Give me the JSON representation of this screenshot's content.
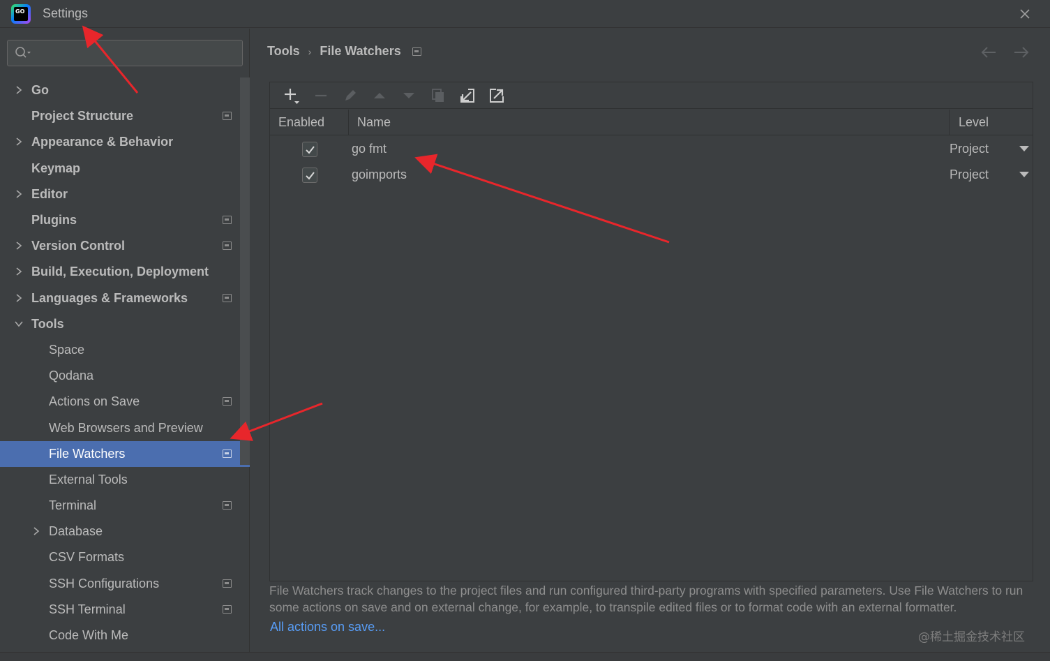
{
  "window": {
    "title": "Settings",
    "logo_text": "GO"
  },
  "search": {
    "placeholder": "",
    "value": ""
  },
  "sidebar": {
    "items": [
      {
        "label": "Go",
        "chevron": "right",
        "bold": true,
        "indent": 0,
        "proj": false
      },
      {
        "label": "Project Structure",
        "chevron": null,
        "bold": true,
        "indent": 0,
        "proj": true
      },
      {
        "label": "Appearance & Behavior",
        "chevron": "right",
        "bold": true,
        "indent": 0,
        "proj": false
      },
      {
        "label": "Keymap",
        "chevron": null,
        "bold": true,
        "indent": 0,
        "proj": false
      },
      {
        "label": "Editor",
        "chevron": "right",
        "bold": true,
        "indent": 0,
        "proj": false
      },
      {
        "label": "Plugins",
        "chevron": null,
        "bold": true,
        "indent": 0,
        "proj": true
      },
      {
        "label": "Version Control",
        "chevron": "right",
        "bold": true,
        "indent": 0,
        "proj": true
      },
      {
        "label": "Build, Execution, Deployment",
        "chevron": "right",
        "bold": true,
        "indent": 0,
        "proj": false
      },
      {
        "label": "Languages & Frameworks",
        "chevron": "right",
        "bold": true,
        "indent": 0,
        "proj": true
      },
      {
        "label": "Tools",
        "chevron": "down",
        "bold": true,
        "indent": 0,
        "proj": false
      },
      {
        "label": "Space",
        "chevron": null,
        "bold": false,
        "indent": 1,
        "proj": false
      },
      {
        "label": "Qodana",
        "chevron": null,
        "bold": false,
        "indent": 1,
        "proj": false
      },
      {
        "label": "Actions on Save",
        "chevron": null,
        "bold": false,
        "indent": 1,
        "proj": true
      },
      {
        "label": "Web Browsers and Preview",
        "chevron": null,
        "bold": false,
        "indent": 1,
        "proj": false
      },
      {
        "label": "File Watchers",
        "chevron": null,
        "bold": false,
        "indent": 1,
        "proj": true,
        "selected": true
      },
      {
        "label": "External Tools",
        "chevron": null,
        "bold": false,
        "indent": 1,
        "proj": false
      },
      {
        "label": "Terminal",
        "chevron": null,
        "bold": false,
        "indent": 1,
        "proj": true
      },
      {
        "label": "Database",
        "chevron": "right",
        "bold": false,
        "indent": 1,
        "proj": false
      },
      {
        "label": "CSV Formats",
        "chevron": null,
        "bold": false,
        "indent": 1,
        "proj": false
      },
      {
        "label": "SSH Configurations",
        "chevron": null,
        "bold": false,
        "indent": 1,
        "proj": true
      },
      {
        "label": "SSH Terminal",
        "chevron": null,
        "bold": false,
        "indent": 1,
        "proj": true
      },
      {
        "label": "Code With Me",
        "chevron": null,
        "bold": false,
        "indent": 1,
        "proj": false
      }
    ]
  },
  "breadcrumb": {
    "parent": "Tools",
    "separator": "›",
    "current": "File Watchers"
  },
  "toolbar": {
    "buttons": [
      {
        "name": "add-button",
        "icon": "plus-icon",
        "enabled": true
      },
      {
        "name": "remove-button",
        "icon": "minus-icon",
        "enabled": false
      },
      {
        "name": "edit-button",
        "icon": "pencil-icon",
        "enabled": false
      },
      {
        "name": "move-up-button",
        "icon": "arrow-up-icon",
        "enabled": false
      },
      {
        "name": "move-down-button",
        "icon": "arrow-down-icon",
        "enabled": false
      },
      {
        "name": "copy-button",
        "icon": "copy-icon",
        "enabled": false
      },
      {
        "name": "import-button",
        "icon": "import-icon",
        "enabled": true
      },
      {
        "name": "export-button",
        "icon": "export-icon",
        "enabled": true
      }
    ]
  },
  "table": {
    "columns": {
      "enabled": "Enabled",
      "name": "Name",
      "level": "Level"
    },
    "rows": [
      {
        "enabled": true,
        "name": "go fmt",
        "level": "Project"
      },
      {
        "enabled": true,
        "name": "goimports",
        "level": "Project"
      }
    ]
  },
  "description": "File Watchers track changes to the project files and run configured third-party programs with specified parameters. Use File Watchers to run some actions on save and on external change, for example, to transpile edited files or to format code with an external formatter.",
  "link": {
    "label": "All actions on save..."
  },
  "watermark": "@稀土掘金技术社区",
  "colors": {
    "background": "#3c3f41",
    "selection": "#4b6eaf",
    "link": "#589df6",
    "annotation": "#e8262b"
  }
}
